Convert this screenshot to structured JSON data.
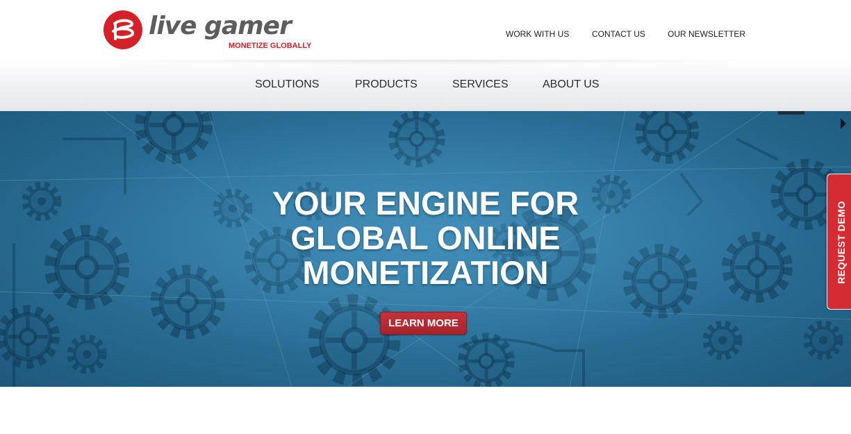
{
  "brand": {
    "name": "live gamer",
    "tagline": "MONETIZE GLOBALLY",
    "accent_color": "#d42027",
    "logo_icon": "live-gamer-logo-icon"
  },
  "top_nav": {
    "items": [
      {
        "label": "WORK WITH US"
      },
      {
        "label": "CONTACT US"
      },
      {
        "label": "OUR NEWSLETTER"
      }
    ]
  },
  "main_nav": {
    "items": [
      {
        "label": "SOLUTIONS"
      },
      {
        "label": "PRODUCTS"
      },
      {
        "label": "SERVICES"
      },
      {
        "label": "ABOUT US"
      }
    ]
  },
  "hero": {
    "title_lines": [
      "YOUR ENGINE FOR",
      "GLOBAL ONLINE",
      "MONETIZATION"
    ],
    "cta_label": "LEARN MORE",
    "background_theme": "gears-icon",
    "next_icon": "next-slide-arrow-icon",
    "colors": {
      "background": "#2c729a",
      "cta": "#b3282f"
    }
  },
  "request_demo": {
    "label": "REQUEST DEMO",
    "color": "#d52b32"
  }
}
